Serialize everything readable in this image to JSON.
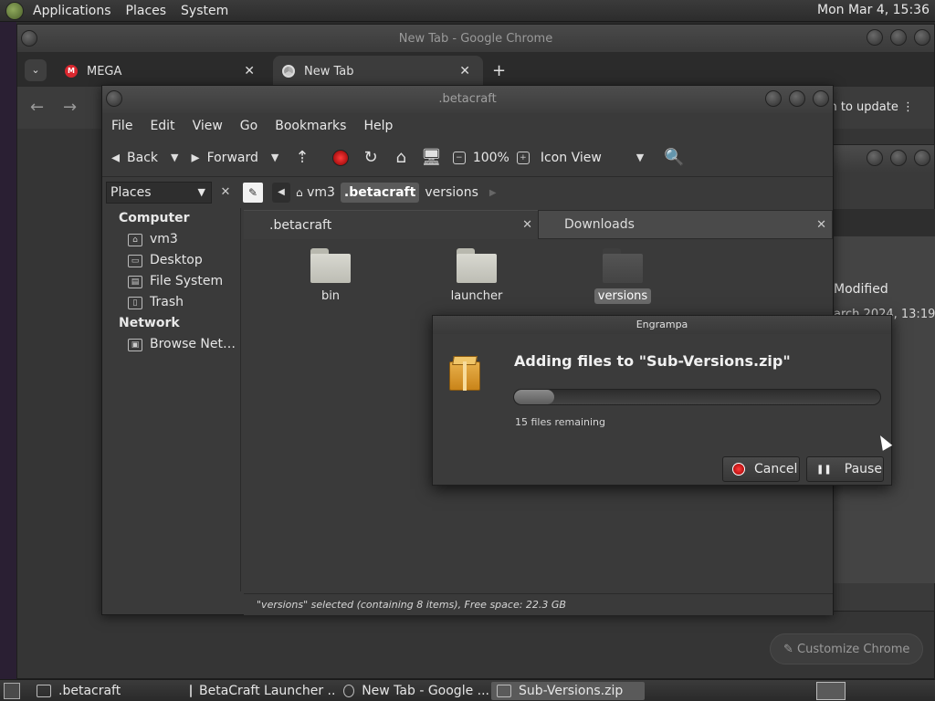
{
  "top_panel": {
    "menus": [
      "Applications",
      "Places",
      "System"
    ],
    "clock": "Mon Mar  4, 15:36"
  },
  "chrome": {
    "window_title": "New Tab - Google Chrome",
    "tabs": [
      {
        "label": "MEGA",
        "icon": "mega-icon"
      },
      {
        "label": "New Tab",
        "icon": "chrome-icon"
      }
    ],
    "relaunch_label": "nch to update",
    "customize_label": "Customize Chrome",
    "bg_modified": "Modified",
    "bg_date": "arch 2024, 13:19"
  },
  "caja": {
    "window_title": ".betacraft",
    "menu": [
      "File",
      "Edit",
      "View",
      "Go",
      "Bookmarks",
      "Help"
    ],
    "toolbar": {
      "back": "Back",
      "forward": "Forward",
      "zoom": "100%",
      "view_mode": "Icon View"
    },
    "places_label": "Places",
    "breadcrumbs": [
      "vm3",
      ".betacraft",
      "versions"
    ],
    "sidebar": {
      "computer_heading": "Computer",
      "computer_items": [
        {
          "label": "vm3",
          "icon": "home-icon"
        },
        {
          "label": "Desktop",
          "icon": "desktop-icon"
        },
        {
          "label": "File System",
          "icon": "drive-icon"
        },
        {
          "label": "Trash",
          "icon": "trash-icon"
        }
      ],
      "network_heading": "Network",
      "network_items": [
        {
          "label": "Browse Net…",
          "icon": "network-icon"
        }
      ]
    },
    "pane_tabs": [
      ".betacraft",
      "Downloads"
    ],
    "files": [
      {
        "name": "bin",
        "selected": false
      },
      {
        "name": "launcher",
        "selected": false
      },
      {
        "name": "versions",
        "selected": true
      }
    ],
    "status": "\"versions\" selected (containing 8 items), Free space: 22.3 GB"
  },
  "engrampa": {
    "title": "Engrampa",
    "heading": "Adding files to \"Sub-Versions.zip\"",
    "progress_fraction": 0.11,
    "remaining": "15 files remaining",
    "cancel_label": "Cancel",
    "pause_label": "Pause"
  },
  "taskbar": {
    "items": [
      ".betacraft",
      "BetaCraft Launcher ...",
      "New Tab - Google ...",
      "Sub-Versions.zip"
    ]
  }
}
